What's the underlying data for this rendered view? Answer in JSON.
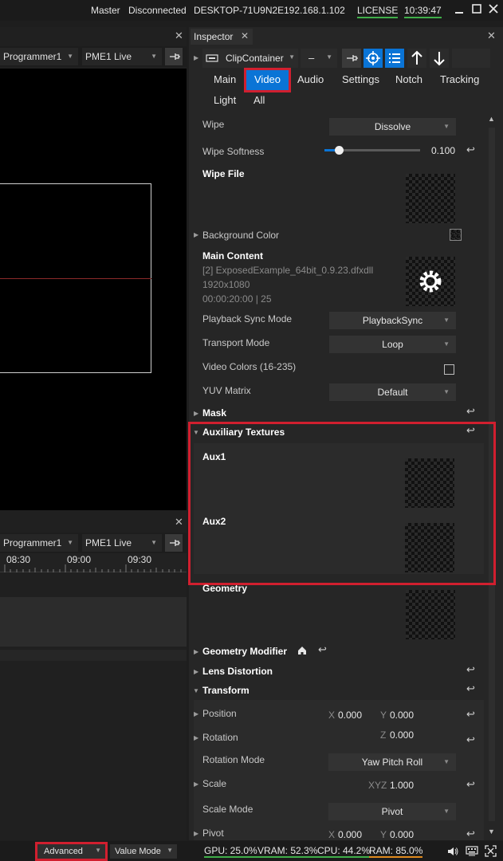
{
  "titlebar": {
    "role": "Master",
    "connection": "Disconnected",
    "hostname": "DESKTOP-71U9N2E",
    "ip": "192.168.1.102",
    "license": "LICENSE",
    "time": "10:39:47"
  },
  "left_top_panel": {
    "programmer": "Programmer1",
    "live": "PME1 Live"
  },
  "left_bottom_panel": {
    "programmer": "Programmer1",
    "live": "PME1 Live",
    "timeline_ticks": [
      "08:30",
      "09:00",
      "09:30"
    ]
  },
  "inspector": {
    "tab_label": "Inspector",
    "target": "ClipContainer",
    "target_dash": "–",
    "tabs": [
      "Main",
      "Video",
      "Audio",
      "Settings",
      "Notch",
      "Tracking",
      "Light",
      "All"
    ],
    "active_tab": "Video",
    "wipe": {
      "label": "Wipe",
      "value": "Dissolve"
    },
    "wipe_softness": {
      "label": "Wipe Softness",
      "value": "0.100",
      "fraction": 0.15
    },
    "wipe_file": "Wipe File",
    "background_color": "Background Color",
    "main_content": {
      "label": "Main Content",
      "file": "[2] ExposedExample_64bit_0.9.23.dfxdll",
      "resolution": "1920x1080",
      "timecode": "00:00:20:00 | 25"
    },
    "playback_sync_mode": {
      "label": "Playback Sync Mode",
      "value": "PlaybackSync"
    },
    "transport_mode": {
      "label": "Transport Mode",
      "value": "Loop"
    },
    "video_colors": {
      "label": "Video Colors (16-235)",
      "checked": false
    },
    "yuv_matrix": {
      "label": "YUV Matrix",
      "value": "Default"
    },
    "mask": "Mask",
    "auxiliary_textures": "Auxiliary Textures",
    "aux1": "Aux1",
    "aux2": "Aux2",
    "geometry": "Geometry",
    "geometry_modifier": "Geometry Modifier",
    "lens_distortion": "Lens Distortion",
    "transform": "Transform",
    "position": {
      "label": "Position",
      "x_label": "X",
      "x": "0.000",
      "y_label": "Y",
      "y": "0.000"
    },
    "rotation": {
      "label": "Rotation",
      "z_label": "Z",
      "z": "0.000"
    },
    "rotation_mode": {
      "label": "Rotation Mode",
      "value": "Yaw Pitch Roll"
    },
    "scale": {
      "label": "Scale",
      "xyz_label": "XYZ",
      "xyz": "1.000"
    },
    "scale_mode": {
      "label": "Scale Mode",
      "value": "Pivot"
    },
    "pivot": {
      "label": "Pivot",
      "x_label": "X",
      "x": "0.000",
      "y_label": "Y",
      "y": "0.000"
    }
  },
  "statusbar": {
    "mode": "Advanced",
    "value_mode": "Value Mode",
    "gpu": "GPU: 25.0%",
    "vram": "VRAM: 52.3%",
    "cpu": "CPU: 44.2%",
    "ram": "RAM: 85.0%"
  },
  "colors": {
    "accent_blue": "#0a74d6",
    "highlight_red": "#d11f2f",
    "meter_green": "#3fae49",
    "meter_orange": "#e08a1e"
  }
}
